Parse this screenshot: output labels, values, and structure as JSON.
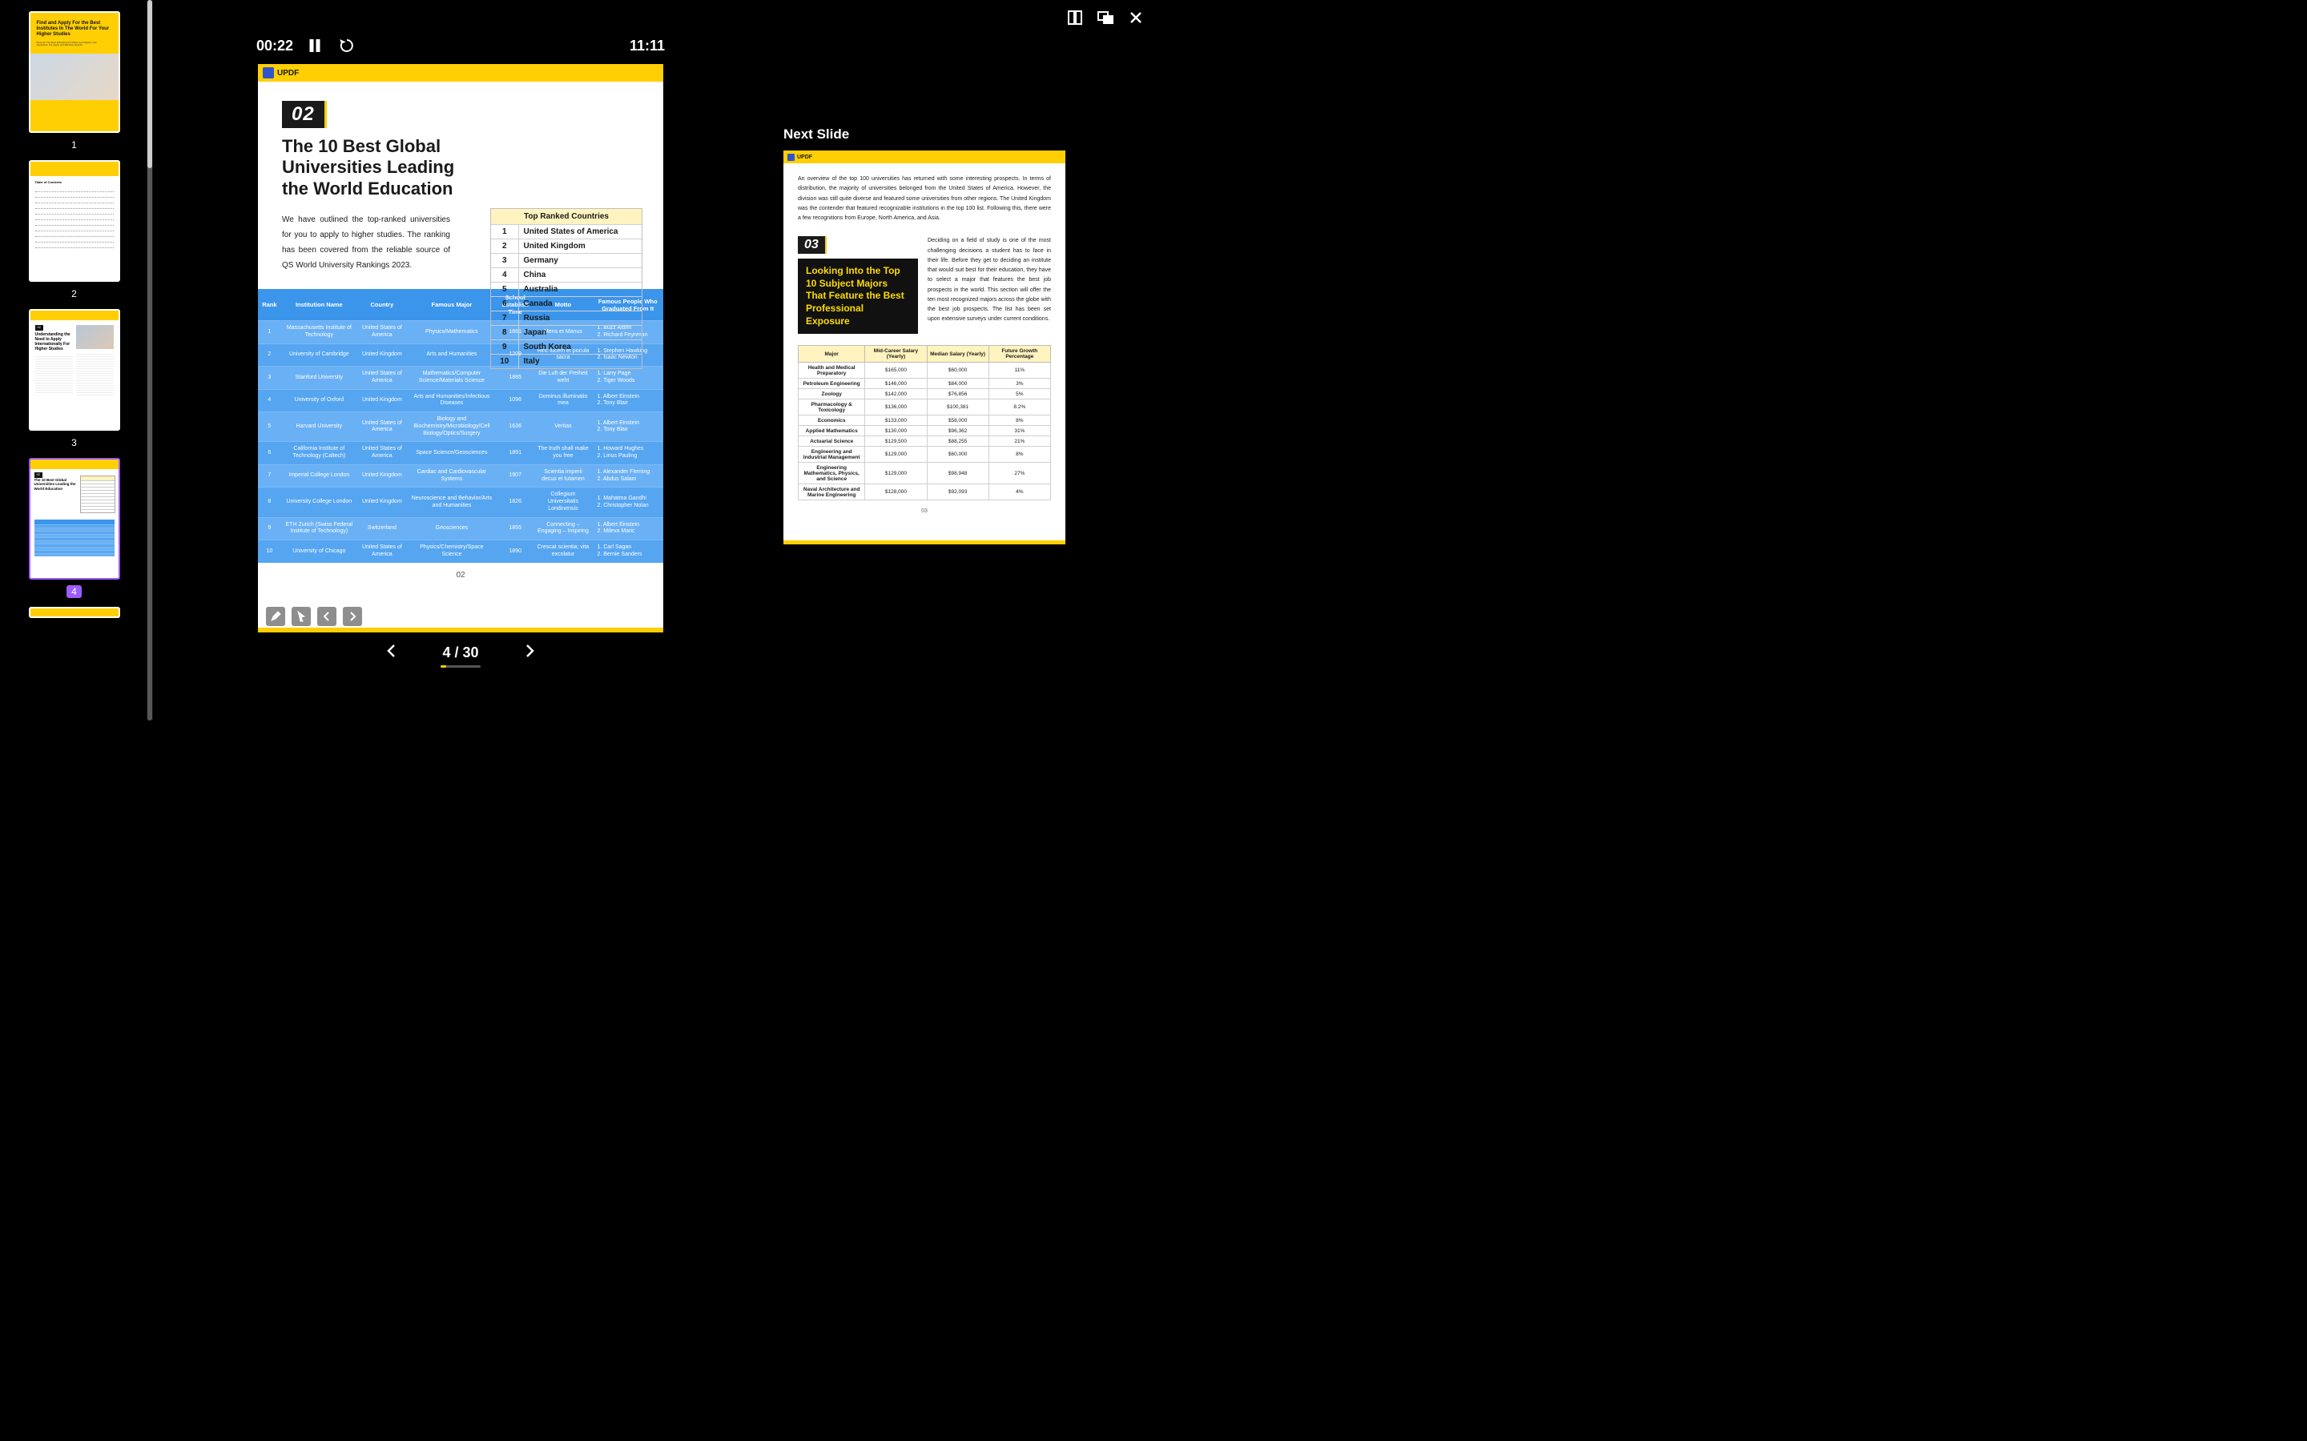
{
  "window": {
    "layout_icon": "layout",
    "pip_icon": "swap",
    "close_icon": "close"
  },
  "playback": {
    "elapsed": "00:22",
    "total": "11:11",
    "pause_icon": "pause",
    "restart_icon": "restart"
  },
  "pager": {
    "current": "4",
    "separator": " / ",
    "total": "30"
  },
  "thumbnails": [
    {
      "num": "1"
    },
    {
      "num": "2"
    },
    {
      "num": "3"
    },
    {
      "num": "4"
    }
  ],
  "thumb1": {
    "title": "Find and Apply For the Best Institutes In The World For Your Higher Studies",
    "sub": "Discover The Best Educational Institute and Digitize Your Application For Quick and Effective Results"
  },
  "thumb2": {
    "title": "Table of Contents"
  },
  "thumb3": {
    "badge": "01",
    "title": "Understanding the Need to Apply Internationally For Higher Studies"
  },
  "thumb4": {
    "badge": "02",
    "title": "The 10 Best Global Universities Leading the World Education"
  },
  "main": {
    "brand": "UPDF",
    "sec_num": "02",
    "sec_title": "The 10 Best Global Universities Leading the World Education",
    "sec_desc": "We have outlined the top-ranked universities for you to apply to higher studies. The ranking has been covered from the reliable source of QS World University Rankings 2023.",
    "page_num": "02",
    "countries_header": "Top Ranked Countries",
    "countries": [
      {
        "rank": "1",
        "name": "United States of America"
      },
      {
        "rank": "2",
        "name": "United Kingdom"
      },
      {
        "rank": "3",
        "name": "Germany"
      },
      {
        "rank": "4",
        "name": "China"
      },
      {
        "rank": "5",
        "name": "Australia"
      },
      {
        "rank": "6",
        "name": "Canada"
      },
      {
        "rank": "7",
        "name": "Russia"
      },
      {
        "rank": "8",
        "name": "Japan"
      },
      {
        "rank": "9",
        "name": "South Korea"
      },
      {
        "rank": "10",
        "name": "Italy"
      }
    ],
    "uni_cols": [
      "Rank",
      "Institution Name",
      "Country",
      "Famous Major",
      "School Establish Time",
      "Motto",
      "Famous People Who Graduated From It"
    ],
    "unis": [
      {
        "rank": "1",
        "name": "Massachusetts Institute of Technology",
        "country": "United States of America",
        "major": "Physics/Mathematics",
        "est": "1861",
        "motto": "Mens et Manus",
        "people": "1. Buzz Aldrin\n2. Richard Feynman"
      },
      {
        "rank": "2",
        "name": "University of Cambridge",
        "country": "United Kingdom",
        "major": "Arts and Humanities",
        "est": "1209",
        "motto": "Hinc lucem et pocula sacra",
        "people": "1. Stephen Hawking\n2. Isaac Newton"
      },
      {
        "rank": "3",
        "name": "Stanford University",
        "country": "United States of America",
        "major": "Mathematics/Computer Science/Materials Science",
        "est": "1885",
        "motto": "Die Luft der Freiheit weht",
        "people": "1. Larry Page\n2. Tiger Woods"
      },
      {
        "rank": "4",
        "name": "University of Oxford",
        "country": "United Kingdom",
        "major": "Arts and Humanities/Infectious Diseases",
        "est": "1096",
        "motto": "Dominus illuminatio mea",
        "people": "1. Albert Einstein\n2. Tony Blair"
      },
      {
        "rank": "5",
        "name": "Harvard University",
        "country": "United States of America",
        "major": "Biology and Biochemistry/Microbiology/Cell Biology/Optics/Surgery",
        "est": "1636",
        "motto": "Veritas",
        "people": "1. Albert Einstein\n2. Tony Blair"
      },
      {
        "rank": "6",
        "name": "California Institute of Technology (Caltech)",
        "country": "United States of America",
        "major": "Space Science/Geosciences",
        "est": "1891",
        "motto": "The truth shall make you free",
        "people": "1. Howard Hughes\n2. Linus Pauling"
      },
      {
        "rank": "7",
        "name": "Imperial College London",
        "country": "United Kingdom",
        "major": "Cardiac and Cardiovascular Systems",
        "est": "1907",
        "motto": "Scientia imperii decus et tutamen",
        "people": "1. Alexander Fleming\n2. Abdus Salam"
      },
      {
        "rank": "8",
        "name": "University College London",
        "country": "United Kingdom",
        "major": "Neuroscience and Behavior/Arts and Humanities",
        "est": "1826",
        "motto": "Collegium Universitatis Londinensis",
        "people": "1. Mahatma Gandhi\n2. Christopher Nolan"
      },
      {
        "rank": "9",
        "name": "ETH Zurich (Swiss Federal Institute of Technology)",
        "country": "Switzerland",
        "major": "Geosciences",
        "est": "1855",
        "motto": "Connecting – Engaging – Inspiring",
        "people": "1. Albert Einstein\n2. Mileva Maric"
      },
      {
        "rank": "10",
        "name": "University of Chicago",
        "country": "United States of America",
        "major": "Physics/Chemistry/Space Science",
        "est": "1890",
        "motto": "Crescat scientia; vita excolatur",
        "people": "1. Carl Sagan\n2. Bernie Sanders"
      }
    ]
  },
  "next": {
    "label": "Next Slide",
    "brand": "UPDF",
    "intro": "An overview of the top 100 universities has returned with some interesting prospects. In terms of distribution, the majority of universities belonged from the United States of America. However, the division was still quite diverse and featured some universities from other regions. The United Kingdom was the contender that featured recognizable institutions in the top 100 list. Following this, there were a few recognitions from Europe, North America, and Asia.",
    "sec_num": "03",
    "callout": "Looking Into the Top 10 Subject Majors That Feature the Best Professional Exposure",
    "rtext": "Deciding on a field of study is one of the most challenging decisions a student has to face in their life. Before they get to deciding an institute that would suit best for their education, they have to select a major that features the best job prospects in the world. This section will offer the ten most recognized majors across the globe with the best job prospects. The list has been set upon extensive surveys under current conditions.",
    "major_cols": [
      "Major",
      "Mid-Career Salary (Yearly)",
      "Median Salary (Yearly)",
      "Future Growth Percentage"
    ],
    "majors": [
      {
        "m": "Health and Medical Preparatory",
        "mid": "$165,000",
        "med": "$60,000",
        "g": "11%"
      },
      {
        "m": "Petroleum Engineering",
        "mid": "$146,000",
        "med": "$84,000",
        "g": "3%"
      },
      {
        "m": "Zoology",
        "mid": "$142,000",
        "med": "$76,856",
        "g": "5%"
      },
      {
        "m": "Pharmacology & Toxicology",
        "mid": "$136,000",
        "med": "$100,381",
        "g": "8.2%"
      },
      {
        "m": "Economics",
        "mid": "$133,000",
        "med": "$58,000",
        "g": "8%"
      },
      {
        "m": "Applied Mathematics",
        "mid": "$130,000",
        "med": "$96,362",
        "g": "31%"
      },
      {
        "m": "Actuarial Science",
        "mid": "$129,500",
        "med": "$88,255",
        "g": "21%"
      },
      {
        "m": "Engineering and Industrial Management",
        "mid": "$129,000",
        "med": "$60,000",
        "g": "8%"
      },
      {
        "m": "Engineering Mathematics, Physics, and Science",
        "mid": "$129,000",
        "med": "$98,948",
        "g": "27%"
      },
      {
        "m": "Naval Architecture and Marine Engineering",
        "mid": "$128,000",
        "med": "$92,093",
        "g": "4%"
      }
    ],
    "page_num": "03"
  },
  "slide_ctrls": {
    "pen": "pen",
    "cursor": "pointer",
    "prev": "prev",
    "next": "next"
  }
}
